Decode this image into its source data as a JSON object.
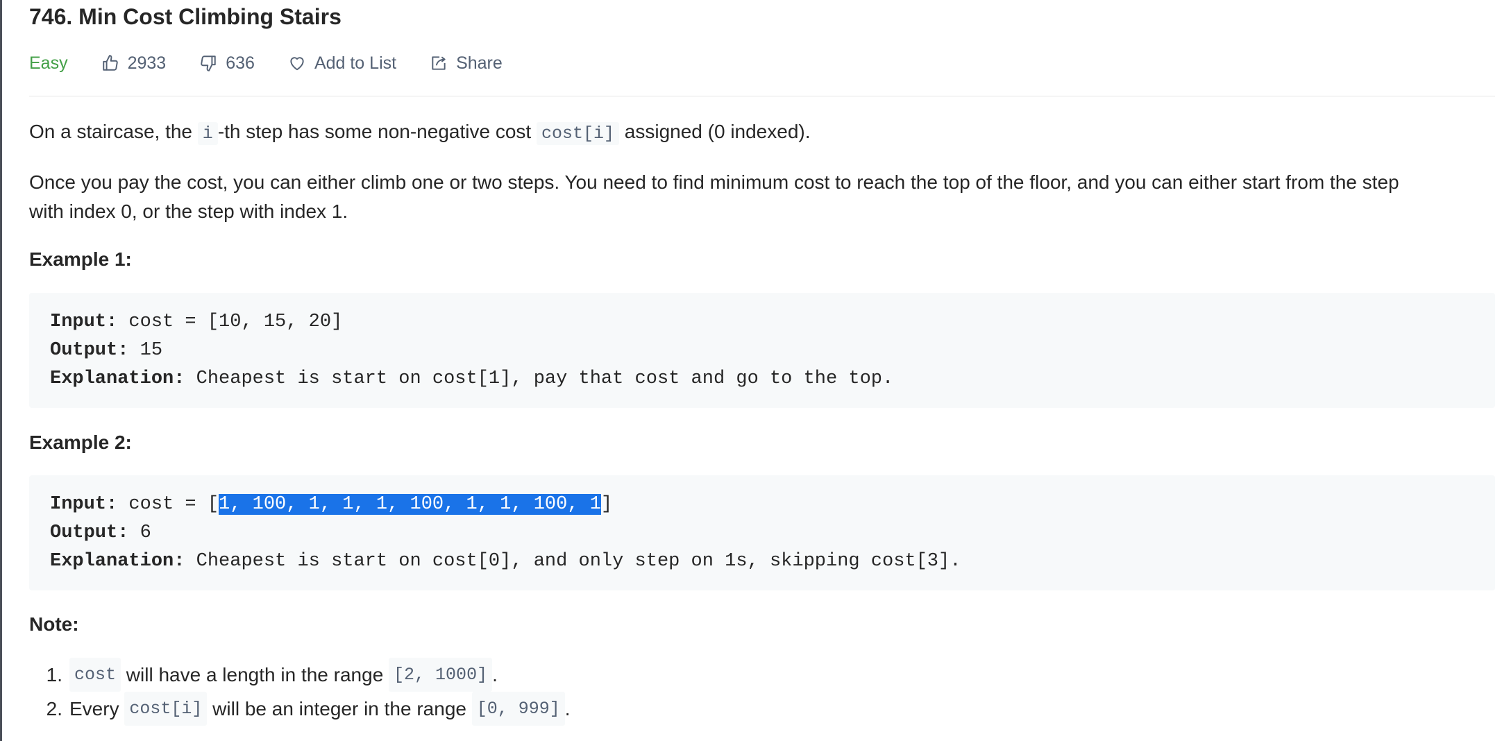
{
  "problem": {
    "title": "746. Min Cost Climbing Stairs",
    "difficulty": "Easy",
    "likes": "2933",
    "dislikes": "636",
    "add_to_list": "Add to List",
    "share": "Share"
  },
  "description": {
    "p1": {
      "a": "On a staircase, the ",
      "code1": "i",
      "b": "-th step has some non-negative cost ",
      "code2": "cost[i]",
      "c": " assigned (0 indexed)."
    },
    "p2_line1": "Once you pay the cost, you can either climb one or two steps. You need to find minimum cost to reach the top of the floor, and you can either start from the step",
    "p2_line2": "with index 0, or the step with index 1."
  },
  "examples": [
    {
      "heading": "Example 1:",
      "input_label": "Input:",
      "input_value": " cost = [10, 15, 20]",
      "output_label": "Output:",
      "output_value": " 15",
      "explanation_label": "Explanation:",
      "explanation_value": " Cheapest is start on cost[1], pay that cost and go to the top."
    },
    {
      "heading": "Example 2:",
      "input_label": "Input:",
      "input_prefix": " cost = [",
      "input_selected": "1, 100, 1, 1, 1, 100, 1, 1, 100, 1",
      "input_suffix": "]",
      "output_label": "Output:",
      "output_value": " 6",
      "explanation_label": "Explanation:",
      "explanation_value": " Cheapest is start on cost[0], and only step on 1s, skipping cost[3]."
    }
  ],
  "note": {
    "heading": "Note:",
    "items": [
      {
        "num": "1.",
        "code1": "cost",
        "text1": " will have a length in the range ",
        "code2": "[2, 1000]",
        "text2": "."
      },
      {
        "num": "2.",
        "pre": "Every ",
        "code1": "cost[i]",
        "text1": " will be an integer in the range ",
        "code2": "[0, 999]",
        "text2": "."
      }
    ]
  },
  "colors": {
    "difficulty_easy": "#43a047",
    "meta_text": "#546174",
    "code_background": "#f7f9fa",
    "selection": "#1a73e8"
  },
  "icons": [
    "thumbs-up-icon",
    "thumbs-down-icon",
    "heart-icon",
    "share-icon"
  ]
}
